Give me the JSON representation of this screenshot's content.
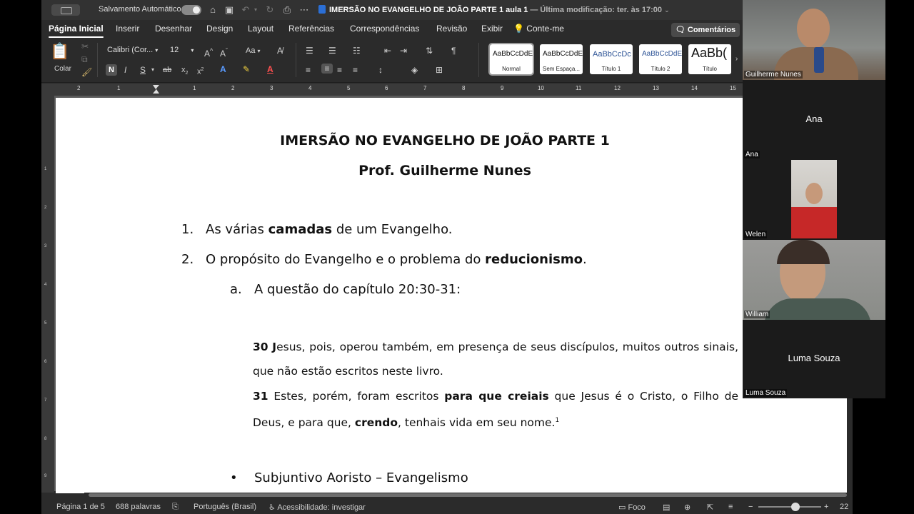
{
  "titlebar": {
    "autosave_label": "Salvamento Automático",
    "doc_name": "IMERSÃO NO EVANGELHO DE JOÃO PARTE 1 aula 1",
    "doc_meta": "— Última modificação: ter. às 17:00"
  },
  "tabs": [
    "Página Inicial",
    "Inserir",
    "Desenhar",
    "Design",
    "Layout",
    "Referências",
    "Correspondências",
    "Revisão",
    "Exibir",
    "Conte-me"
  ],
  "comments_label": "Comentários",
  "ribbon": {
    "paste_label": "Colar",
    "font_name": "Calibri (Cor...",
    "font_size": "12",
    "bold": "N",
    "italic": "I",
    "underline": "S",
    "strike": "ab",
    "subscript": "x",
    "superscript": "x",
    "change_case": "Aa",
    "styles": [
      {
        "sample": "AaBbCcDdEe",
        "label": "Normal"
      },
      {
        "sample": "AaBbCcDdEe",
        "label": "Sem Espaça..."
      },
      {
        "sample": "AaBbCcDc",
        "label": "Título 1"
      },
      {
        "sample": "AaBbCcDdEe",
        "label": "Título 2"
      },
      {
        "sample": "AaBb(",
        "label": "Título"
      }
    ]
  },
  "ruler_numbers": [
    "2",
    "1",
    "1",
    "1",
    "2",
    "3",
    "4",
    "5",
    "6",
    "7",
    "8",
    "9",
    "10",
    "11",
    "12",
    "13",
    "14",
    "15"
  ],
  "vruler_numbers": [
    "1",
    "2",
    "3",
    "4",
    "5",
    "6",
    "7",
    "8",
    "9"
  ],
  "document": {
    "title": "IMERSÃO NO EVANGELHO DE JOÃO PARTE 1",
    "author": "Prof. Guilherme Nunes",
    "item1_num": "1.",
    "item1_pre": "As várias ",
    "item1_bold": "camadas",
    "item1_post": " de um Evangelho.",
    "item2_num": "2.",
    "item2_pre": "O propósito do Evangelho e o problema do ",
    "item2_bold": "reducionismo",
    "item2_post": ".",
    "sub_a_num": "a.",
    "sub_a": "A questão do capítulo 20:30-31:",
    "v30_num": "30",
    "v30_initial": "J",
    "v30_text": "esus, pois, operou também, em presença de seus discípulos, muitos outros sinais, que não estão escritos neste livro.",
    "v31_num": "31",
    "v31_pre": " Estes, porém, foram escritos ",
    "v31_bold": "para que creiais",
    "v31_mid": " que Jesus é o Cristo, o Filho de Deus, e para que, ",
    "v31_bold2": "crendo",
    "v31_post": ", tenhais vida em seu nome.",
    "footnote": "1",
    "bullet": "Subjuntivo Aoristo – Evangelismo"
  },
  "status": {
    "page": "Página 1 de 5",
    "words": "688 palavras",
    "language": "Português (Brasil)",
    "accessibility": "Acessibilidade: investigar",
    "focus": "Foco",
    "zoom_value": "22",
    "zoom_minus": "−",
    "zoom_plus": "+"
  },
  "participants": [
    {
      "name": "Guilherme Nunes",
      "video": true
    },
    {
      "name": "Ana",
      "video": false
    },
    {
      "name": "Welen",
      "video": true
    },
    {
      "name": "William",
      "video": true
    },
    {
      "name": "Luma Souza",
      "video": false
    }
  ]
}
